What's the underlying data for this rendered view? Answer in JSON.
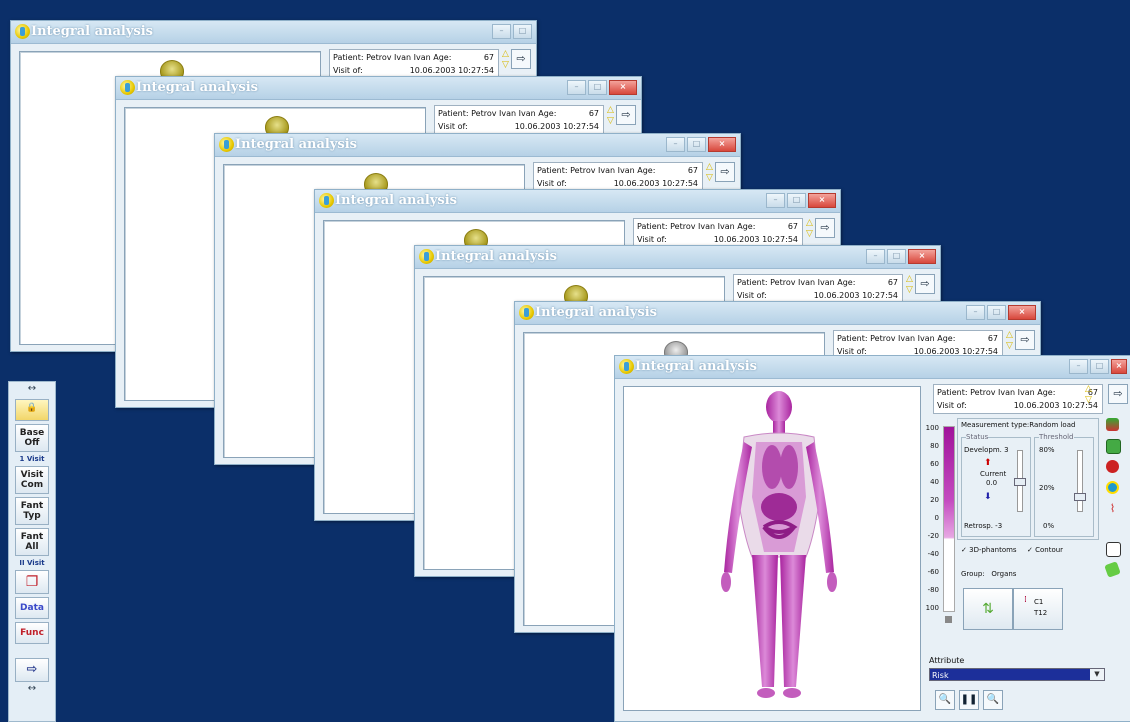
{
  "window": {
    "title": "Integral analysis",
    "patient_label": "Patient:",
    "patient_name": "Petrov Ivan Ivan",
    "age_label": "Age:",
    "age": "67",
    "visit_label": "Visit of:",
    "visit_date": "10.06.2003",
    "visit_time": "10:27:54"
  },
  "toolbar": {
    "top_arrow": "↔",
    "base_off": "Base\nOff",
    "first_visit": "1 Visit",
    "visit_com": "Visit\nCom",
    "fant_typ": "Fant\nTyp",
    "fant_all": "Fant\nAll",
    "second_visit": "II Visit",
    "data": "Data",
    "func": "Func",
    "bottom_arrow": "↔"
  },
  "scale": {
    "ticks": [
      "100",
      "80",
      "60",
      "40",
      "20",
      "0",
      "-20",
      "-40",
      "-60",
      "-80",
      "100"
    ]
  },
  "measurement": {
    "label": "Measurement type:",
    "value": "Random load",
    "status_title": "Status",
    "threshold_title": "Threshold",
    "develop_label": "Developm.",
    "develop_value": "3",
    "current_label": "Current",
    "current_value": "0.0",
    "retro_label": "Retrosp.",
    "retro_value": "-3",
    "th_80": "80%",
    "th_20": "20%",
    "th_0": "0%",
    "phantoms_label": "3D-phantoms",
    "contour_label": "Contour",
    "group_label": "Group:",
    "group_value": "Organs",
    "c1": "C1",
    "t12": "T12"
  },
  "attribute": {
    "label": "Attribute",
    "value": "Risk"
  },
  "colors": {
    "desktop": "#0b2f69",
    "phantom": "#c45cc6"
  }
}
